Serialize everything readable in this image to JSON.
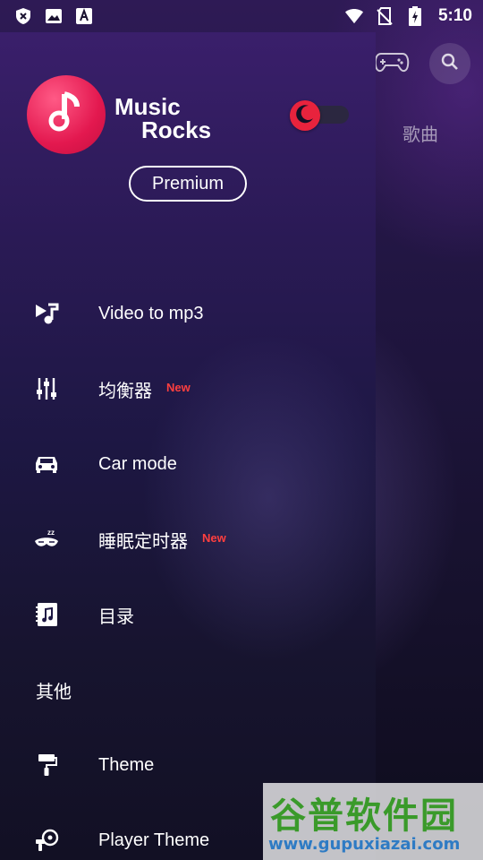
{
  "status_bar": {
    "time": "5:10",
    "left_icons": [
      "close-shield-icon",
      "image-icon",
      "text-a-icon"
    ],
    "right_icons": [
      "wifi-icon",
      "no-sim-icon",
      "battery-charging-icon"
    ]
  },
  "background": {
    "tab_label": "歌曲",
    "icons": [
      "gamepad-icon",
      "search-icon"
    ]
  },
  "drawer": {
    "logo": {
      "line1": "Music",
      "line2": "Rocks",
      "icon": "music-note-icon",
      "color": "#e3184f"
    },
    "night_mode": {
      "icon": "moon-icon",
      "enabled": false,
      "color": "#e8233d"
    },
    "premium_label": "Premium",
    "menu_items": [
      {
        "label": "Video to mp3",
        "icon": "video-music-icon",
        "badge": ""
      },
      {
        "label": "均衡器",
        "icon": "equalizer-icon",
        "badge": "New"
      },
      {
        "label": "Car mode",
        "icon": "car-icon",
        "badge": ""
      },
      {
        "label": "睡眠定时器",
        "icon": "sleep-mask-icon",
        "badge": "New"
      },
      {
        "label": "目录",
        "icon": "music-book-icon",
        "badge": ""
      }
    ],
    "section_other": "其他",
    "other_items": [
      {
        "label": "Theme",
        "icon": "paint-roller-icon"
      },
      {
        "label": "Player Theme",
        "icon": "player-theme-icon"
      }
    ],
    "badge_color": "#ff3f3f"
  },
  "watermark": {
    "title": "谷普软件园",
    "url": "www.gupuxiazai.com"
  }
}
